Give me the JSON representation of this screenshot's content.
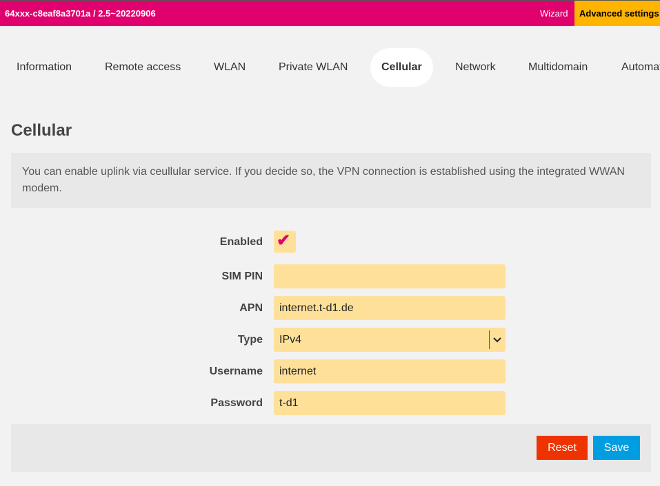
{
  "header": {
    "device": "64xxx-c8eaf8a3701a / 2.5~20220906",
    "wizard_label": "Wizard",
    "advanced_label": "Advanced settings"
  },
  "tabs": [
    {
      "label": "Information",
      "active": false
    },
    {
      "label": "Remote access",
      "active": false
    },
    {
      "label": "WLAN",
      "active": false
    },
    {
      "label": "Private WLAN",
      "active": false
    },
    {
      "label": "Cellular",
      "active": true
    },
    {
      "label": "Network",
      "active": false
    },
    {
      "label": "Multidomain",
      "active": false
    },
    {
      "label": "Automat",
      "active": false
    }
  ],
  "page": {
    "title": "Cellular",
    "info": "You can enable uplink via ceullular service. If you decide so, the VPN connection is established using the integrated WWAN modem."
  },
  "form": {
    "enabled": {
      "label": "Enabled",
      "checked": true,
      "check_glyph": "✔"
    },
    "sim_pin": {
      "label": "SIM PIN",
      "value": ""
    },
    "apn": {
      "label": "APN",
      "value": "internet.t-d1.de"
    },
    "type": {
      "label": "Type",
      "value": "IPv4"
    },
    "username": {
      "label": "Username",
      "value": "internet"
    },
    "password": {
      "label": "Password",
      "value": "t-d1"
    }
  },
  "actions": {
    "reset_label": "Reset",
    "save_label": "Save"
  },
  "colors": {
    "brand": "#e0006e",
    "accent": "#ffb400",
    "field": "#ffe099",
    "reset": "#ee3300",
    "save": "#009ee0"
  },
  "icons": {
    "check": "checkmark-icon",
    "select_arrow": "chevron-down-icon"
  }
}
